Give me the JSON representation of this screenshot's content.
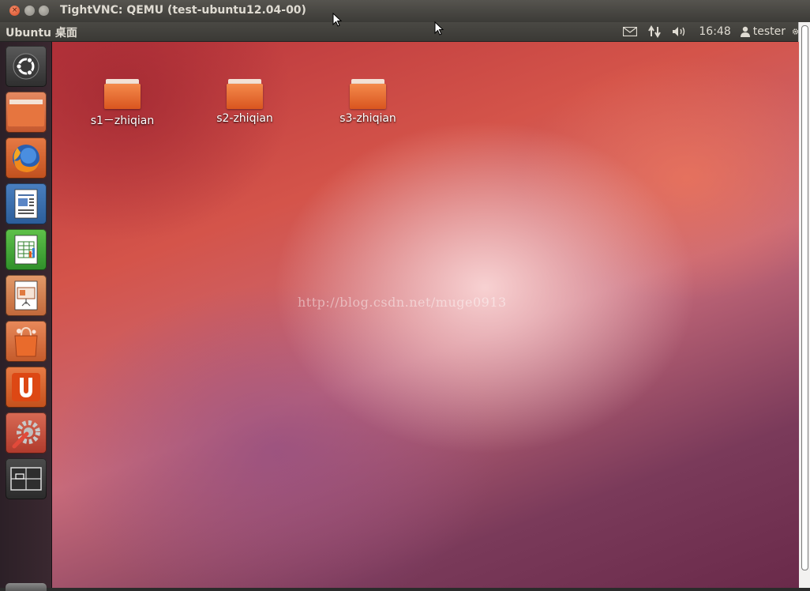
{
  "window": {
    "title": "TightVNC: QEMU (test-ubuntu12.04-00)",
    "close_glyph": "×"
  },
  "panel": {
    "title": "Ubuntu 桌面",
    "clock": "16:48",
    "user": "tester",
    "icons": [
      "mail-icon",
      "network-icon",
      "volume-icon",
      "user-icon",
      "gear-icon"
    ]
  },
  "launcher": {
    "items": [
      {
        "name": "dash-home",
        "icon": "ubuntu-logo-icon"
      },
      {
        "name": "home-folder",
        "icon": "folder-icon"
      },
      {
        "name": "firefox",
        "icon": "firefox-icon"
      },
      {
        "name": "libreoffice-writer",
        "icon": "writer-icon"
      },
      {
        "name": "libreoffice-calc",
        "icon": "calc-icon"
      },
      {
        "name": "libreoffice-impress",
        "icon": "impress-icon"
      },
      {
        "name": "software-center",
        "icon": "shopping-bag-icon"
      },
      {
        "name": "ubuntu-one",
        "icon": "ubuntu-one-icon"
      },
      {
        "name": "system-settings",
        "icon": "settings-wrench-icon"
      },
      {
        "name": "workspace-switcher",
        "icon": "workspace-icon"
      }
    ]
  },
  "desktop": {
    "icons": [
      {
        "label": "s1－zhiqian"
      },
      {
        "label": "s2-zhiqian"
      },
      {
        "label": "s3-zhiqian"
      }
    ],
    "watermark": "http://blog.csdn.net/muge0913"
  },
  "colors": {
    "accent": "#dd4814",
    "panel": "#3c3b37",
    "launcher": "#2c2027"
  }
}
